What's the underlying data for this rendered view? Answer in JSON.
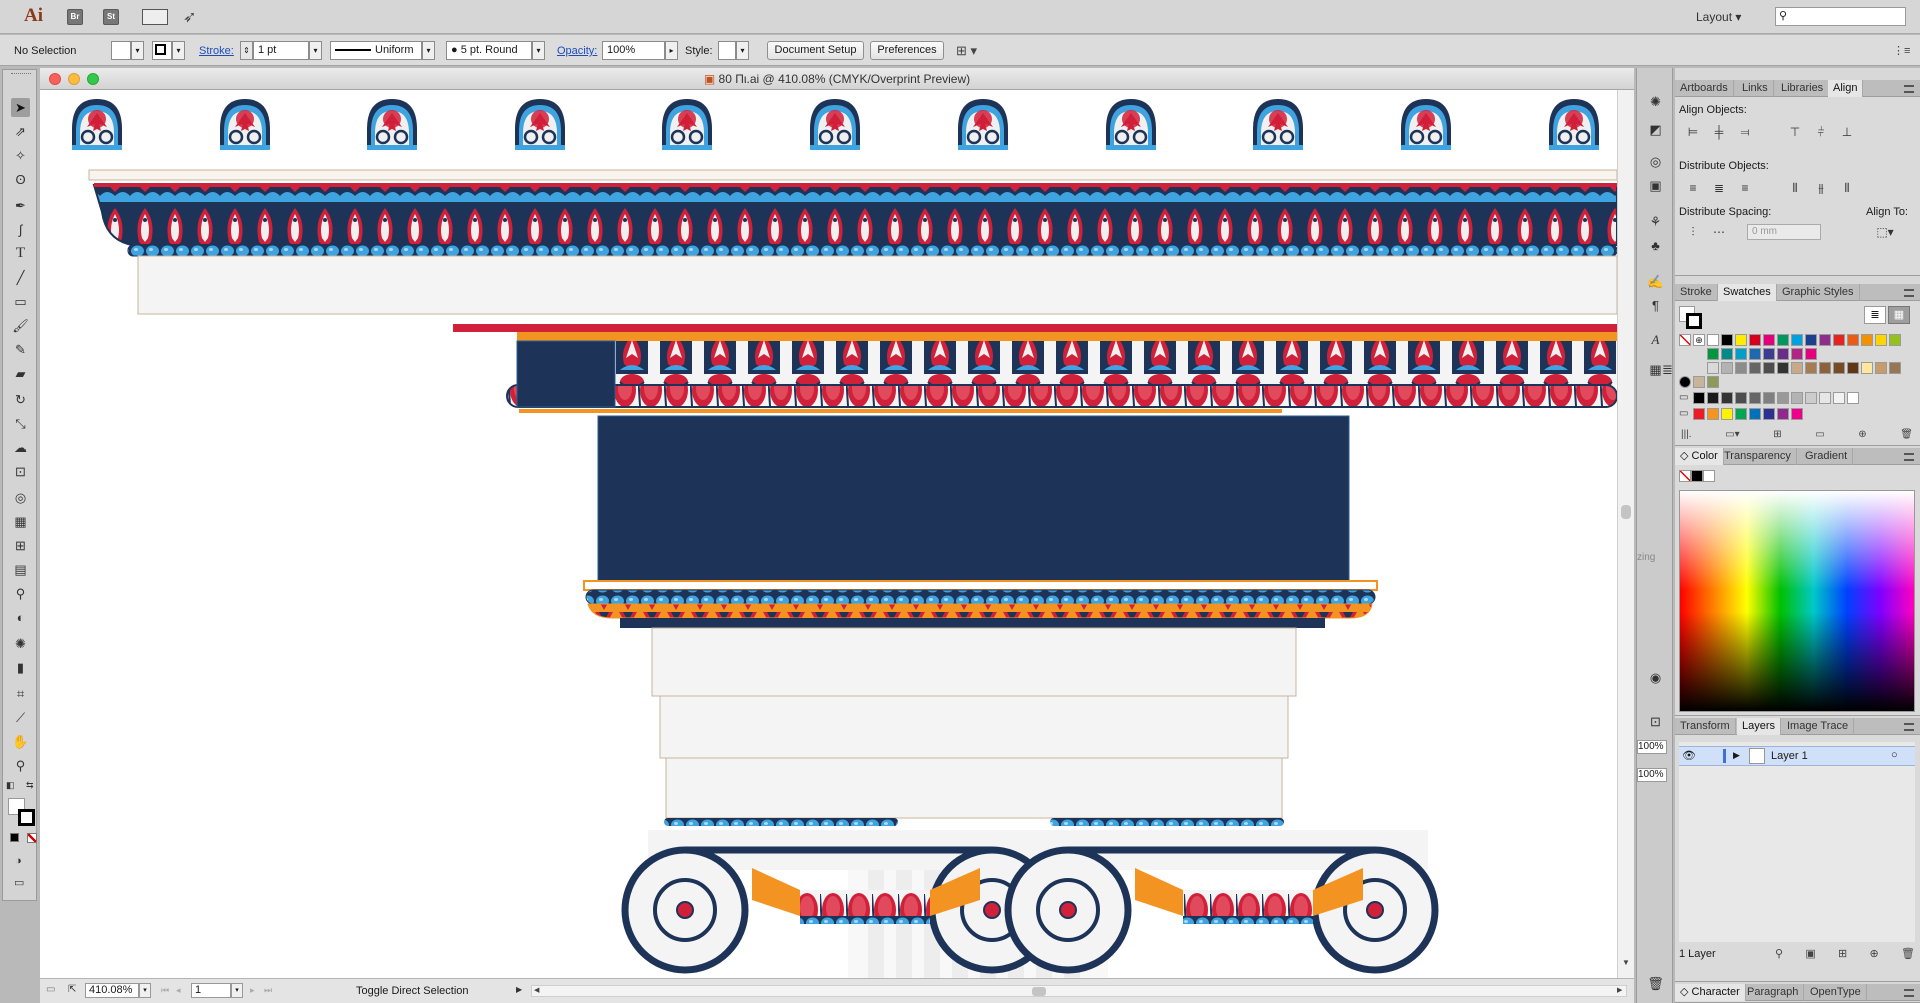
{
  "app": {
    "logo": "Ai",
    "bridge": "Br",
    "stock": "St",
    "workspace": "Layout",
    "search_placeholder": ""
  },
  "control": {
    "selection": "No Selection",
    "stroke_label": "Stroke:",
    "stroke_weight": "1 pt",
    "profile": "Uniform",
    "brush": "5 pt. Round",
    "opacity_label": "Opacity:",
    "opacity_value": "100%",
    "style_label": "Style:",
    "document_setup": "Document Setup",
    "preferences": "Preferences"
  },
  "document": {
    "title": "80 Πι.ai @ 410.08% (CMYK/Overprint Preview)",
    "zoom": "410.08%",
    "artboard": "1",
    "status": "Toggle Direct Selection",
    "panel_fragment": "zing",
    "small_zoom_a": "100%",
    "small_zoom_b": "100%"
  },
  "panels": {
    "align_tabs": [
      "Artboards",
      "Links",
      "Libraries",
      "Align"
    ],
    "align_objects": "Align Objects:",
    "distribute_objects": "Distribute Objects:",
    "distribute_spacing": "Distribute Spacing:",
    "align_to": "Align To:",
    "spacing_value": "0 mm",
    "swatch_tabs": [
      "Stroke",
      "Swatches",
      "Graphic Styles"
    ],
    "color_tabs": [
      "Color",
      "Transparency",
      "Gradient"
    ],
    "layer_tabs": [
      "Transform",
      "Layers",
      "Image Trace"
    ],
    "layer_name": "Layer 1",
    "layer_count": "1 Layer",
    "char_tabs": [
      "Character",
      "Paragraph",
      "OpenType"
    ]
  },
  "colors": {
    "navy": "#1d3358",
    "red": "#d1203a",
    "light_blue": "#3ea3df",
    "orange": "#f39321",
    "cream": "#f4f4f4",
    "tan": "#c8b39b",
    "selection_blue": "#cfe0f8"
  },
  "swatches": {
    "row1": [
      "#ffffff",
      "#000000",
      "#ffec00",
      "#d6001c",
      "#e3007a",
      "#00985f",
      "#00a1de",
      "#1d3f8f",
      "#8e2e8c",
      "#e52421",
      "#ea5c16",
      "#f39200",
      "#ffd400",
      "#95c11f",
      "#009640",
      "#008b8a",
      "#00a0c6",
      "#1f69b1",
      "#3c3d8f",
      "#6a2c89",
      "#b12584",
      "#e5007e"
    ],
    "row2": [
      "#d9d9d9",
      "#b3b3b3",
      "#8c8c8c",
      "#666666",
      "#4d4d4d",
      "#333333",
      "#c7a98c",
      "#a67c52",
      "#8c6239",
      "#754c24",
      "#603813",
      "#ffe6a1",
      "#c69c6d",
      "#997653"
    ],
    "grays": [
      "#000000",
      "#1a1a1a",
      "#333333",
      "#4d4d4d",
      "#666666",
      "#808080",
      "#999999",
      "#b3b3b3",
      "#cccccc",
      "#e6e6e6",
      "#f2f2f2",
      "#ffffff"
    ],
    "brights": [
      "#ed1c24",
      "#f7941d",
      "#fff200",
      "#00a651",
      "#0072bc",
      "#2e3192",
      "#92278f",
      "#ec008c"
    ]
  },
  "icons": {
    "tools": [
      "selection-tool-icon",
      "direct-selection-tool-icon",
      "magic-wand-icon",
      "lasso-icon",
      "pen-tool-icon",
      "curvature-icon",
      "type-tool-icon",
      "line-tool-icon",
      "rectangle-tool-icon",
      "paintbrush-icon",
      "pencil-icon",
      "eraser-icon",
      "rotate-tool-icon",
      "scale-tool-icon",
      "warp-tool-icon",
      "free-transform-icon",
      "shape-builder-icon",
      "perspective-grid-icon",
      "mesh-tool-icon",
      "gradient-tool-icon",
      "eyedropper-icon",
      "blend-tool-icon",
      "symbol-sprayer-icon",
      "column-graph-icon",
      "artboard-tool-icon",
      "slice-tool-icon",
      "hand-tool-icon",
      "zoom-tool-icon"
    ]
  }
}
